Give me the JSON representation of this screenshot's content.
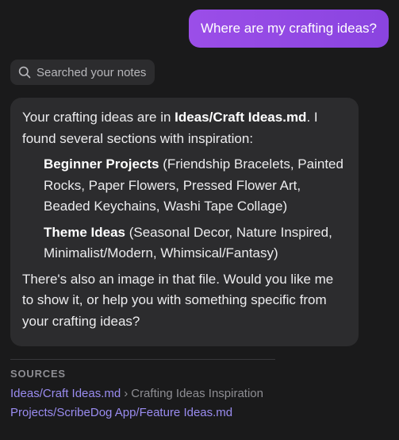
{
  "user_message": "Where are my crafting ideas?",
  "search_chip": {
    "label": "Searched your notes",
    "icon": "search-icon"
  },
  "answer": {
    "intro_pre": "Your crafting ideas are in ",
    "intro_file": "Ideas/Craft Ideas.md",
    "intro_post": ". I found several sections with inspiration:",
    "items": [
      {
        "title": "Beginner Projects",
        "details": " (Friendship Bracelets, Painted Rocks, Paper Flowers, Pressed Flower Art, Beaded Keychains, Washi Tape Collage)"
      },
      {
        "title": "Theme Ideas",
        "details": " (Seasonal Decor, Nature Inspired, Minimalist/Modern, Whimsical/Fantasy)"
      }
    ],
    "outro": "There's also an image in that file. Would you like me to show it, or help you with something specific from your crafting ideas?"
  },
  "sources": {
    "title": "SOURCES",
    "items": [
      {
        "link": "Ideas/Craft Ideas.md",
        "separator": "›",
        "section": "Crafting Ideas Inspiration"
      },
      {
        "link": "Projects/ScribeDog App/Feature Ideas.md"
      }
    ]
  },
  "colors": {
    "background": "#1a1a1b",
    "user_bubble": "#9b4ee8",
    "bubble": "#2c2c2e",
    "link": "#9a8cf0",
    "muted": "#8e8e93"
  }
}
